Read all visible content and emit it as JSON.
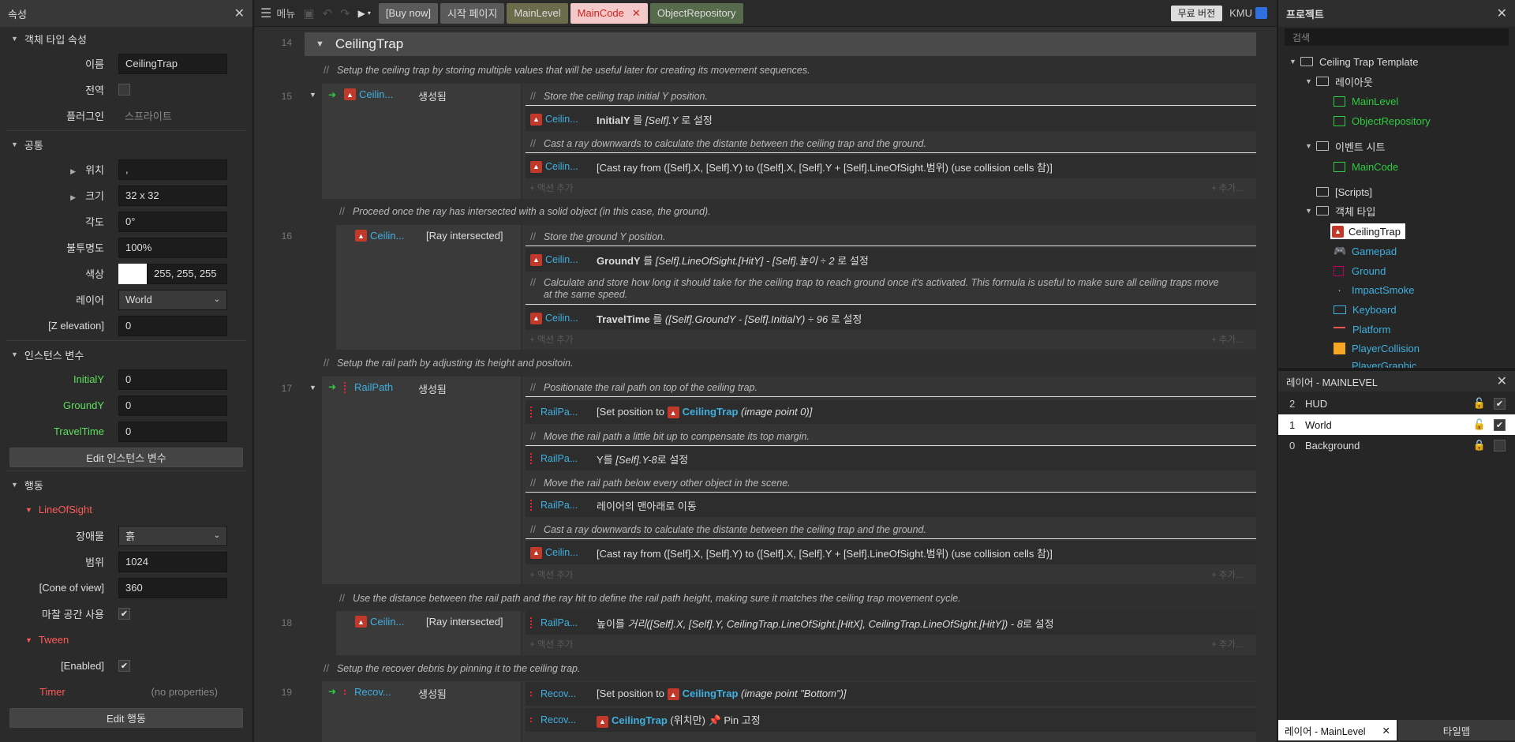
{
  "properties": {
    "title": "속성",
    "object_type_section": "객체 타입 속성",
    "name_label": "이름",
    "name_value": "CeilingTrap",
    "global_label": "전역",
    "plugin_label": "플러그인",
    "plugin_value": "스프라이트",
    "common_section": "공통",
    "position_label": "위치",
    "position_value": ",",
    "size_label": "크기",
    "size_value": "32 x 32",
    "angle_label": "각도",
    "angle_value": "0°",
    "opacity_label": "불투명도",
    "opacity_value": "100%",
    "color_label": "색상",
    "color_value": "255, 255, 255",
    "layer_label": "레이어",
    "layer_value": "World",
    "z_label": "[Z elevation]",
    "z_value": "0",
    "instvar_section": "인스턴스 변수",
    "instvars": [
      {
        "name": "InitialY",
        "value": "0"
      },
      {
        "name": "GroundY",
        "value": "0"
      },
      {
        "name": "TravelTime",
        "value": "0"
      }
    ],
    "edit_instvars": "Edit 인스턴스 변수",
    "behaviors_section": "행동",
    "los_name": "LineOfSight",
    "obstacles_label": "장애물",
    "obstacles_value": "흙",
    "range_label": "범위",
    "range_value": "1024",
    "cone_label": "[Cone of view]",
    "cone_value": "360",
    "friction_label": "마찰 공간 사용",
    "tween_name": "Tween",
    "enabled_label": "[Enabled]",
    "timer_name": "Timer",
    "timer_value": "(no properties)",
    "edit_behaviors": "Edit 행동"
  },
  "toolbar": {
    "menu": "메뉴",
    "tabs": [
      "[Buy now]",
      "시작 페이지",
      "MainLevel",
      "MainCode",
      "ObjectRepository"
    ],
    "free_version": "무료 버전",
    "user": "KMU"
  },
  "events": {
    "group_title": "CeilingTrap",
    "line_numbers": [
      "14",
      "15",
      "16",
      "17",
      "18",
      "19"
    ],
    "c1": "Setup the ceiling trap by storing multiple values that will be useful later for creating its movement sequences.",
    "ev15_obj": "Ceilin...",
    "ev15_cond": "생성됨",
    "a15_c1": "Store the ceiling trap initial Y position.",
    "a15_1_obj": "Ceilin...",
    "a15_1_pre": "InitialY",
    "a15_1_mid": " 를 ",
    "a15_1_val": "[Self].Y",
    "a15_1_post": " 로 설정",
    "a15_c2": "Cast a ray downwards to calculate the distante between the ceiling trap and the ground.",
    "a15_2_obj": "Ceilin...",
    "a15_2_txt": "[Cast ray from ([Self].X, [Self].Y) to ([Self].X, [Self].Y + [Self].LineOfSight.범위) (use collision cells 참)]",
    "add_action": "+ 액션 추가",
    "add_more": "+ 추가...",
    "c2": "Proceed once the ray has intersected with a solid object (in this case, the ground).",
    "ev16_obj": "Ceilin...",
    "ev16_cond": "[Ray intersected]",
    "a16_c1": "Store the ground Y position.",
    "a16_1_obj": "Ceilin...",
    "a16_1_pre": "GroundY",
    "a16_1_mid": " 를 ",
    "a16_1_val": "[Self].LineOfSight.[HitY] - [Self].높이 ÷ 2",
    "a16_1_post": " 로 설정",
    "a16_c2": "Calculate and store how long it should take for the ceiling trap to reach ground once it's activated. This formula is useful to make sure all ceiling traps move at the same speed.",
    "a16_2_obj": "Ceilin...",
    "a16_2_pre": "TravelTime",
    "a16_2_mid": " 를 ",
    "a16_2_val": "([Self].GroundY - [Self].InitialY) ÷ 96",
    "a16_2_post": " 로 설정",
    "c3": "Setup the rail path by adjusting its height and positoin.",
    "ev17_obj": "RailPath",
    "ev17_cond": "생성됨",
    "a17_c1": "Positionate the rail path on top of the ceiling trap.",
    "a17_1_obj": "RailPa...",
    "a17_1_pre": "[Set position to ",
    "a17_1_obj2": "CeilingTrap",
    "a17_1_post": " (image point 0)]",
    "a17_c2": "Move the rail path a little bit up to compensate its top margin.",
    "a17_2_obj": "RailPa...",
    "a17_2_txt1": "Y를 ",
    "a17_2_val": "[Self].Y-8",
    "a17_2_txt2": "로 설정",
    "a17_c3": "Move the rail path below every other object in the scene.",
    "a17_3_obj": "RailPa...",
    "a17_3_txt": "레이어의 맨아래로 이동",
    "a17_c4": "Cast a ray downwards to calculate the distante between the ceiling trap and the ground.",
    "a17_4_obj": "Ceilin...",
    "a17_4_txt": "[Cast ray from ([Self].X, [Self].Y) to ([Self].X, [Self].Y + [Self].LineOfSight.범위) (use collision cells 참)]",
    "c4": "Use the distance between the rail path and the ray hit to define the rail path height, making sure it matches the ceiling trap movement cycle.",
    "ev18_obj": "Ceilin...",
    "ev18_cond": "[Ray intersected]",
    "a18_1_obj": "RailPa...",
    "a18_1_txt1": "높이를 ",
    "a18_1_val": "거리([Self].X, [Self].Y, CeilingTrap.LineOfSight.[HitX], CeilingTrap.LineOfSight.[HitY]) - 8",
    "a18_1_txt2": "로 설정",
    "c5": "Setup the recover debris by pinning it to the ceiling trap.",
    "ev19_obj": "Recov...",
    "ev19_cond": "생성됨",
    "a19_1_obj": "Recov...",
    "a19_1_pre": "[Set position to ",
    "a19_1_obj2": "CeilingTrap",
    "a19_1_post": " (image point \"Bottom\")]",
    "a19_2_obj": "Recov...",
    "a19_2_obj2": "CeilingTrap",
    "a19_2_mid": " (위치만) ",
    "a19_2_post": "Pin 고정"
  },
  "project": {
    "title": "프로젝트",
    "search_placeholder": "검색",
    "root": "Ceiling Trap Template",
    "layouts_folder": "레이아웃",
    "layouts": [
      "MainLevel",
      "ObjectRepository"
    ],
    "eventsheets_folder": "이벤트 시트",
    "eventsheets": [
      "MainCode"
    ],
    "scripts_folder": "[Scripts]",
    "objtypes_folder": "객체 타입",
    "objtypes": [
      "CeilingTrap",
      "Gamepad",
      "Ground",
      "ImpactSmoke",
      "Keyboard",
      "Platform",
      "PlayerCollision",
      "PlayerGraphic"
    ]
  },
  "layers": {
    "title": "레이어 - MAINLEVEL",
    "items": [
      {
        "index": "2",
        "name": "HUD"
      },
      {
        "index": "1",
        "name": "World"
      },
      {
        "index": "0",
        "name": "Background"
      }
    ],
    "bottom_tab1": "레이어 - MainLevel",
    "bottom_tab2": "타일맵"
  },
  "colors": {
    "accent_cyan": "#3fb0e0",
    "green": "#5de05d",
    "red": "#ff5a5a"
  }
}
